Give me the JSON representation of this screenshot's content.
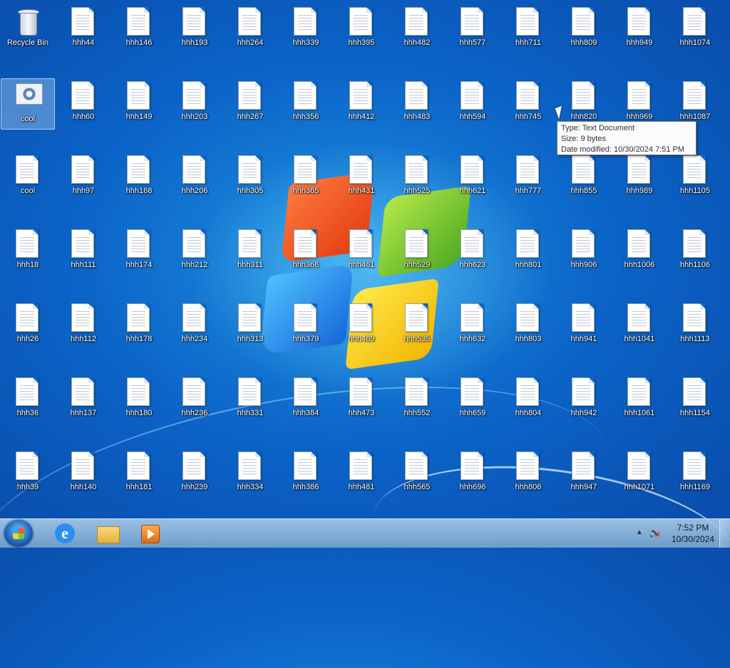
{
  "desktop": {
    "icons": [
      {
        "label": "Recycle Bin",
        "type": "bin"
      },
      {
        "label": "hhh44",
        "type": "txt"
      },
      {
        "label": "hhh146",
        "type": "txt"
      },
      {
        "label": "hhh193",
        "type": "txt"
      },
      {
        "label": "hhh264",
        "type": "txt"
      },
      {
        "label": "hhh339",
        "type": "txt"
      },
      {
        "label": "hhh395",
        "type": "txt"
      },
      {
        "label": "hhh482",
        "type": "txt"
      },
      {
        "label": "hhh577",
        "type": "txt"
      },
      {
        "label": "hhh711",
        "type": "txt"
      },
      {
        "label": "hhh809",
        "type": "txt"
      },
      {
        "label": "hhh949",
        "type": "txt"
      },
      {
        "label": "hhh1074",
        "type": "txt"
      },
      {
        "label": "cool",
        "type": "gear",
        "selected": true
      },
      {
        "label": "hhh60",
        "type": "txt"
      },
      {
        "label": "hhh149",
        "type": "txt"
      },
      {
        "label": "hhh203",
        "type": "txt"
      },
      {
        "label": "hhh267",
        "type": "txt"
      },
      {
        "label": "hhh356",
        "type": "txt"
      },
      {
        "label": "hhh412",
        "type": "txt"
      },
      {
        "label": "hhh483",
        "type": "txt"
      },
      {
        "label": "hhh594",
        "type": "txt"
      },
      {
        "label": "hhh745",
        "type": "txt"
      },
      {
        "label": "hhh820",
        "type": "txt"
      },
      {
        "label": "hhh969",
        "type": "txt"
      },
      {
        "label": "hhh1087",
        "type": "txt"
      },
      {
        "label": "cool",
        "type": "txt"
      },
      {
        "label": "hhh97",
        "type": "txt"
      },
      {
        "label": "hhh168",
        "type": "txt"
      },
      {
        "label": "hhh206",
        "type": "txt"
      },
      {
        "label": "hhh305",
        "type": "txt"
      },
      {
        "label": "hhh365",
        "type": "txt"
      },
      {
        "label": "hhh431",
        "type": "txt"
      },
      {
        "label": "hhh525",
        "type": "txt"
      },
      {
        "label": "hhh621",
        "type": "txt"
      },
      {
        "label": "hhh777",
        "type": "txt"
      },
      {
        "label": "hhh855",
        "type": "txt"
      },
      {
        "label": "hhh989",
        "type": "txt"
      },
      {
        "label": "hhh1105",
        "type": "txt"
      },
      {
        "label": "hhh18",
        "type": "txt"
      },
      {
        "label": "hhh111",
        "type": "txt"
      },
      {
        "label": "hhh174",
        "type": "txt"
      },
      {
        "label": "hhh212",
        "type": "txt"
      },
      {
        "label": "hhh311",
        "type": "txt"
      },
      {
        "label": "hhh366",
        "type": "txt"
      },
      {
        "label": "hhh461",
        "type": "txt"
      },
      {
        "label": "hhh529",
        "type": "txt"
      },
      {
        "label": "hhh623",
        "type": "txt"
      },
      {
        "label": "hhh801",
        "type": "txt"
      },
      {
        "label": "hhh906",
        "type": "txt"
      },
      {
        "label": "hhh1006",
        "type": "txt"
      },
      {
        "label": "hhh1106",
        "type": "txt"
      },
      {
        "label": "hhh26",
        "type": "txt"
      },
      {
        "label": "hhh112",
        "type": "txt"
      },
      {
        "label": "hhh178",
        "type": "txt"
      },
      {
        "label": "hhh234",
        "type": "txt"
      },
      {
        "label": "hhh313",
        "type": "txt"
      },
      {
        "label": "hhh379",
        "type": "txt"
      },
      {
        "label": "hhh469",
        "type": "txt"
      },
      {
        "label": "hhh535",
        "type": "txt"
      },
      {
        "label": "hhh632",
        "type": "txt"
      },
      {
        "label": "hhh803",
        "type": "txt"
      },
      {
        "label": "hhh941",
        "type": "txt"
      },
      {
        "label": "hhh1041",
        "type": "txt"
      },
      {
        "label": "hhh1113",
        "type": "txt"
      },
      {
        "label": "hhh36",
        "type": "txt"
      },
      {
        "label": "hhh137",
        "type": "txt"
      },
      {
        "label": "hhh180",
        "type": "txt"
      },
      {
        "label": "hhh236",
        "type": "txt"
      },
      {
        "label": "hhh331",
        "type": "txt"
      },
      {
        "label": "hhh384",
        "type": "txt"
      },
      {
        "label": "hhh473",
        "type": "txt"
      },
      {
        "label": "hhh552",
        "type": "txt"
      },
      {
        "label": "hhh659",
        "type": "txt"
      },
      {
        "label": "hhh804",
        "type": "txt"
      },
      {
        "label": "hhh942",
        "type": "txt"
      },
      {
        "label": "hhh1061",
        "type": "txt"
      },
      {
        "label": "hhh1154",
        "type": "txt"
      },
      {
        "label": "hhh39",
        "type": "txt"
      },
      {
        "label": "hhh140",
        "type": "txt"
      },
      {
        "label": "hhh181",
        "type": "txt"
      },
      {
        "label": "hhh239",
        "type": "txt"
      },
      {
        "label": "hhh334",
        "type": "txt"
      },
      {
        "label": "hhh386",
        "type": "txt"
      },
      {
        "label": "hhh481",
        "type": "txt"
      },
      {
        "label": "hhh565",
        "type": "txt"
      },
      {
        "label": "hhh696",
        "type": "txt"
      },
      {
        "label": "hhh806",
        "type": "txt"
      },
      {
        "label": "hhh947",
        "type": "txt"
      },
      {
        "label": "hhh1071",
        "type": "txt"
      },
      {
        "label": "hhh1169",
        "type": "txt"
      }
    ]
  },
  "tooltip": {
    "type": "Type: Text Document",
    "size": "Size: 9 bytes",
    "modified": "Date modified: 10/30/2024 7:51 PM"
  },
  "taskbar": {
    "pinned": [
      {
        "name": "internet-explorer",
        "icon": "ie-icon"
      },
      {
        "name": "windows-explorer",
        "icon": "folder-icon"
      },
      {
        "name": "media-player",
        "icon": "media-player-icon"
      }
    ],
    "clock": {
      "time": "7:52 PM",
      "date": "10/30/2024"
    },
    "tray": {
      "show_hidden": "▲",
      "volume": "muted"
    }
  }
}
